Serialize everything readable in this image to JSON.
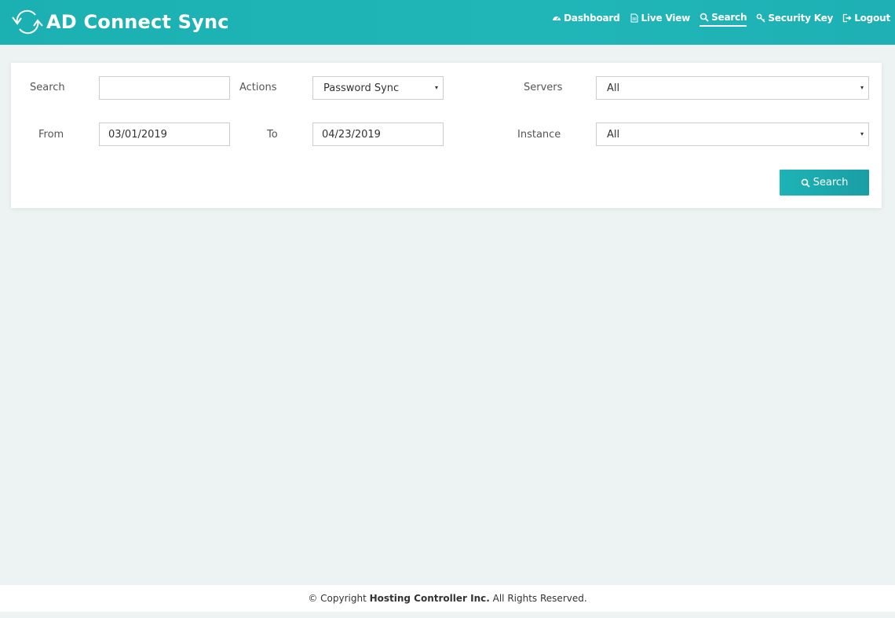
{
  "app": {
    "title": "AD Connect Sync",
    "logo_icon": "sync-icon"
  },
  "nav": {
    "items": [
      {
        "label": "Dashboard",
        "icon": "dashboard-icon",
        "active": false
      },
      {
        "label": "Live View",
        "icon": "document-icon",
        "active": false
      },
      {
        "label": "Search",
        "icon": "search-icon",
        "active": true
      },
      {
        "label": "Security Key",
        "icon": "key-icon",
        "active": false
      },
      {
        "label": "Logout",
        "icon": "logout-icon",
        "active": false
      }
    ]
  },
  "form": {
    "search_label": "Search",
    "search_value": "",
    "actions_label": "Actions",
    "actions_value": "Password Sync",
    "servers_label": "Servers",
    "servers_value": "All",
    "from_label": "From",
    "from_value": "03/01/2019",
    "to_label": "To",
    "to_value": "04/23/2019",
    "instance_label": "Instance",
    "instance_value": "All",
    "search_button_label": "Search",
    "caret": "▾"
  },
  "footer": {
    "prefix": "© Copyright ",
    "company": "Hosting Controller Inc.",
    "suffix": " All Rights Reserved."
  },
  "colors": {
    "header": "#1eb3b5",
    "accent": "#1cb4b5",
    "background": "#edf3f2"
  }
}
